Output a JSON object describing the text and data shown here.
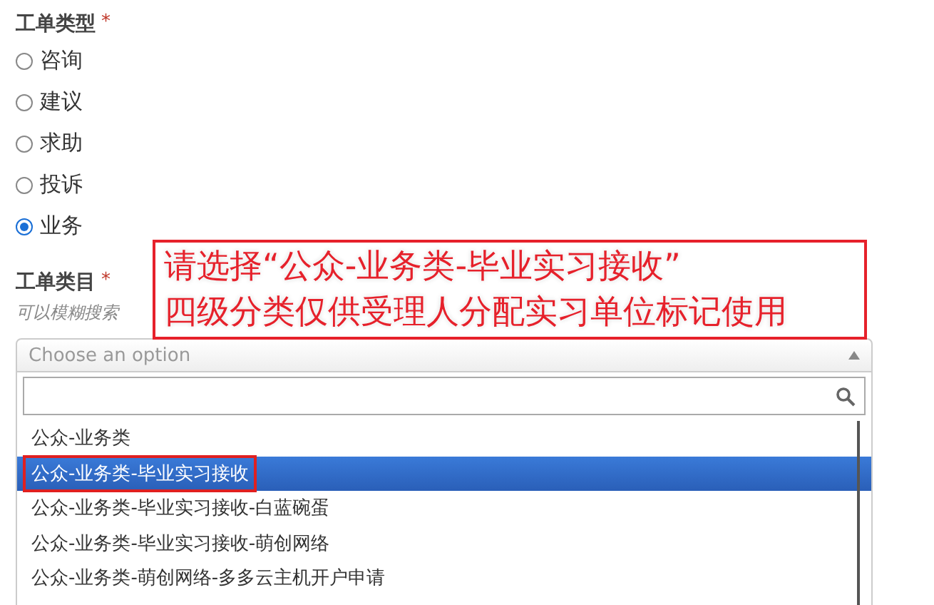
{
  "ticket_type": {
    "label": "工单类型",
    "required_mark": "*",
    "options": [
      {
        "label": "咨询",
        "selected": false
      },
      {
        "label": "建议",
        "selected": false
      },
      {
        "label": "求助",
        "selected": false
      },
      {
        "label": "投诉",
        "selected": false
      },
      {
        "label": "业务",
        "selected": true
      }
    ]
  },
  "ticket_category": {
    "label": "工单类目",
    "required_mark": "*",
    "hint": "可以模糊搜索",
    "select": {
      "placeholder": "Choose an option",
      "expanded": true
    },
    "options": [
      {
        "label": "公众-业务类",
        "selected": false,
        "highlighted": false
      },
      {
        "label": "公众-业务类-毕业实习接收",
        "selected": true,
        "highlighted": true
      },
      {
        "label": "公众-业务类-毕业实习接收-白蓝碗蛋",
        "selected": false,
        "highlighted": false
      },
      {
        "label": "公众-业务类-毕业实习接收-萌创网络",
        "selected": false,
        "highlighted": false
      },
      {
        "label": "公众-业务类-萌创网络-多多云主机开户申请",
        "selected": false,
        "highlighted": false
      }
    ]
  },
  "annotation": {
    "lines": [
      "请选择“公众-业务类-毕业实习接收”",
      "四级分类仅供受理人分配实习单位标记使用"
    ]
  }
}
